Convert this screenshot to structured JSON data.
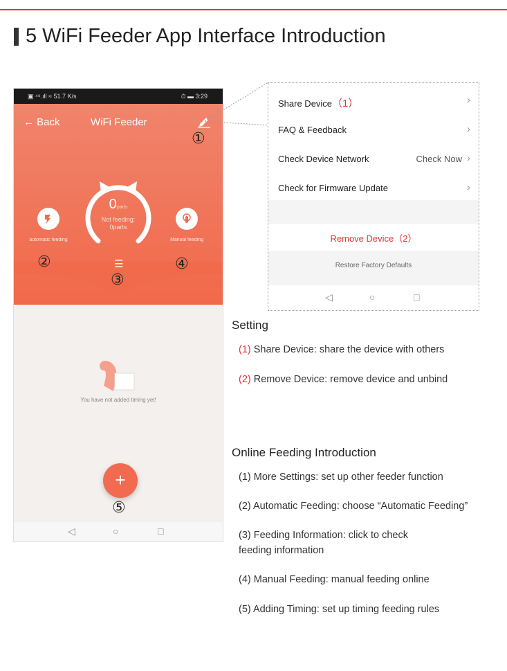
{
  "heading": "5 WiFi Feeder App Interface Introduction",
  "phone": {
    "status_left": "▣ ⁴⁶.ıll ≈ 51.7 K/s",
    "status_right": "⏱ ▬ 3:29",
    "back": "← Back",
    "title": "WiFi Feeder",
    "ring_value": "0",
    "ring_unit": "parts",
    "ring_sub": "Not feeding: 0parts",
    "auto_label": "automatic feeding",
    "manual_label": "Manual feeding",
    "empty": "You have not added timing yet!",
    "fab": "+",
    "nums": [
      "①",
      "②",
      "③",
      "④",
      "⑤"
    ]
  },
  "panel": {
    "share": "Share Device",
    "share_num": "（1）",
    "faq": "FAQ & Feedback",
    "network": "Check Device Network",
    "check_now": "Check Now",
    "firmware": "Check for Firmware Update",
    "remove": "Remove Device（2）",
    "restore": "Restore Factory Defaults",
    "chev": "›"
  },
  "setting": {
    "title": "Setting",
    "items": [
      {
        "num": "(1)",
        "text": " Share Device: share the device with others"
      },
      {
        "num": "(2)",
        "text": " Remove Device: remove device and unbind"
      }
    ]
  },
  "online": {
    "title": "Online Feeding Introduction",
    "items": [
      "(1) More Settings: set up other feeder function",
      "(2) Automatic Feeding: choose “Automatic Feeding”",
      "(3) Feeding Information: click to check",
      "feeding information",
      "(4) Manual Feeding: manual feeding online",
      "(5) Adding Timing: set up timing feeding rules"
    ]
  },
  "nav_glyphs": [
    "◁",
    "○",
    "□"
  ]
}
